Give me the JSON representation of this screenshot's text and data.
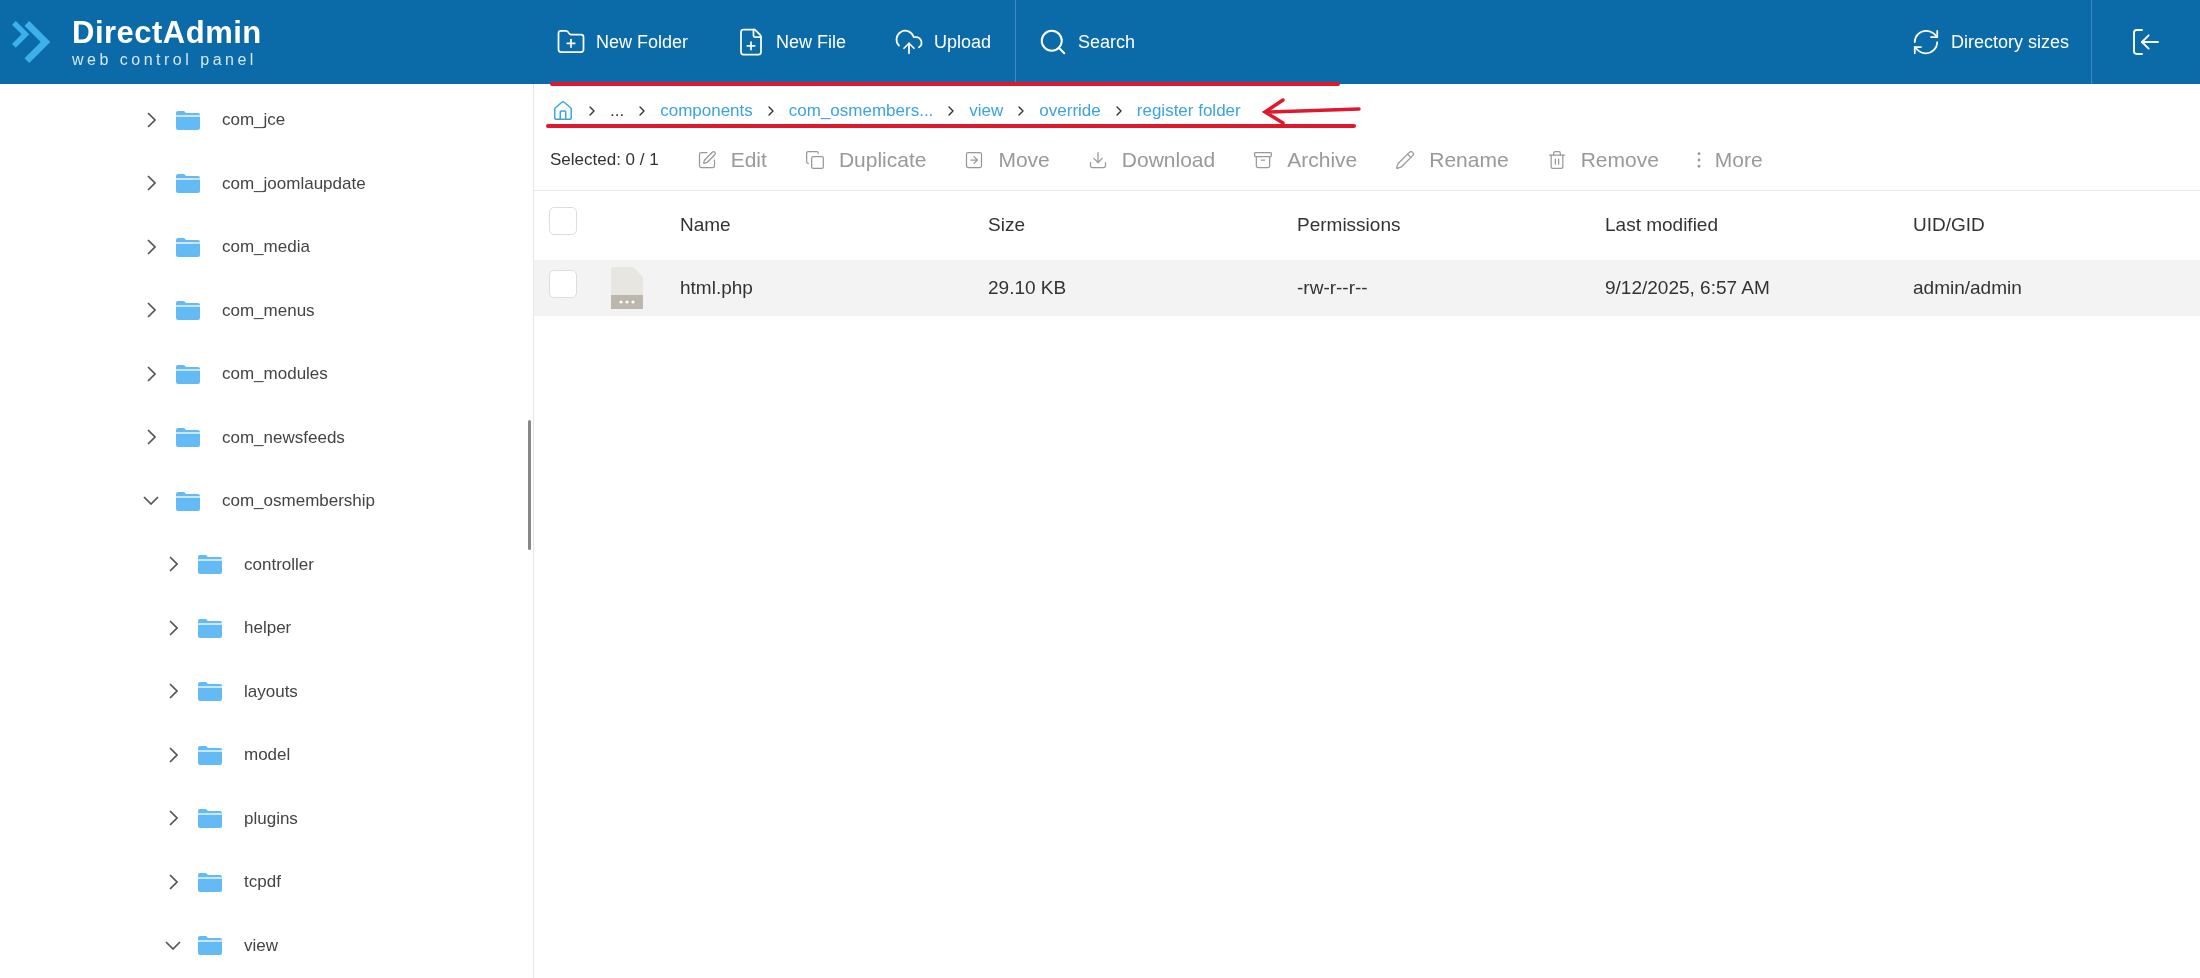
{
  "header": {
    "logo": {
      "name": "DirectAdmin",
      "tagline": "web control panel"
    },
    "actions": [
      {
        "label": "New Folder",
        "kind": "new-folder"
      },
      {
        "label": "New File",
        "kind": "new-file"
      },
      {
        "label": "Upload",
        "kind": "upload"
      }
    ],
    "search": {
      "label": "Search"
    },
    "directory_sizes": {
      "label": "Directory sizes"
    }
  },
  "sidebar": {
    "tree": [
      {
        "label": "com_jce",
        "expanded": false
      },
      {
        "label": "com_joomlaupdate",
        "expanded": false
      },
      {
        "label": "com_media",
        "expanded": false
      },
      {
        "label": "com_menus",
        "expanded": false
      },
      {
        "label": "com_modules",
        "expanded": false
      },
      {
        "label": "com_newsfeeds",
        "expanded": false
      },
      {
        "label": "com_osmembership",
        "expanded": true,
        "children": [
          {
            "label": "controller",
            "expanded": false
          },
          {
            "label": "helper",
            "expanded": false
          },
          {
            "label": "layouts",
            "expanded": false
          },
          {
            "label": "model",
            "expanded": false
          },
          {
            "label": "plugins",
            "expanded": false
          },
          {
            "label": "tcpdf",
            "expanded": false
          },
          {
            "label": "view",
            "expanded": true
          }
        ]
      }
    ]
  },
  "breadcrumb": [
    "...",
    "components",
    "com_osmembers...",
    "view",
    "override",
    "register folder"
  ],
  "toolbar": {
    "selected": "Selected: 0 / 1",
    "actions": [
      {
        "label": "Edit",
        "kind": "edit"
      },
      {
        "label": "Duplicate",
        "kind": "duplicate"
      },
      {
        "label": "Move",
        "kind": "move"
      },
      {
        "label": "Download",
        "kind": "download"
      },
      {
        "label": "Archive",
        "kind": "archive"
      },
      {
        "label": "Rename",
        "kind": "rename"
      },
      {
        "label": "Remove",
        "kind": "remove"
      },
      {
        "label": "More",
        "kind": "more"
      }
    ]
  },
  "table": {
    "header_checked": false,
    "columns": [
      "Name",
      "Size",
      "Permissions",
      "Last modified",
      "UID/GID"
    ],
    "rows": [
      {
        "checked": false,
        "cells": [
          "html.php",
          "29.10 KB",
          "-rw-r--r--",
          "9/12/2025, 6:57 AM",
          "admin/admin"
        ]
      }
    ]
  }
}
